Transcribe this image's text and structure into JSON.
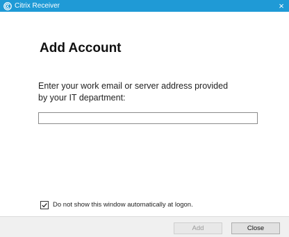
{
  "window": {
    "title": "Citrix Receiver",
    "close_glyph": "×",
    "icon": "citrix-receiver-icon",
    "titlebar_color": "#1f9ad6"
  },
  "main": {
    "heading": "Add Account",
    "instruction_line1": "Enter your work email or server address provided",
    "instruction_line2": "by your IT department:",
    "address_input": {
      "value": "",
      "placeholder": ""
    }
  },
  "options": {
    "dont_show_checked": true,
    "dont_show_label": "Do not show this window automatically at logon."
  },
  "footer": {
    "add_label": "Add",
    "add_enabled": false,
    "close_label": "Close"
  }
}
